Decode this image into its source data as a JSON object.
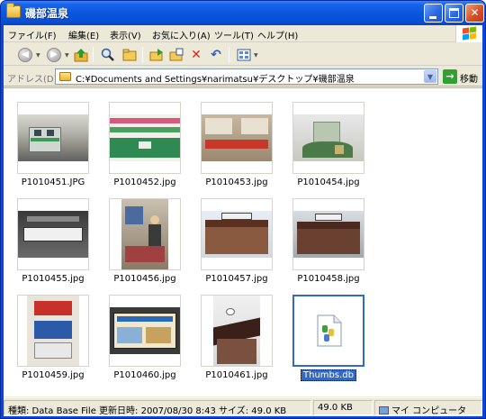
{
  "window": {
    "title": "磯部温泉"
  },
  "menu": {
    "items": [
      "ファイル(F)",
      "編集(E)",
      "表示(V)",
      "お気に入り(A)",
      "ツール(T)",
      "ヘルプ(H)"
    ]
  },
  "toolbar": {
    "icons": [
      "back-icon",
      "forward-icon",
      "up-folder-icon",
      "search-icon",
      "folders-icon",
      "move-to-icon",
      "copy-to-icon",
      "delete-icon",
      "undo-icon",
      "views-icon"
    ]
  },
  "address": {
    "label": "アドレス(D)",
    "path": "C:¥Documents and Settings¥narimatsu¥デスクトップ¥磯部温泉",
    "go_label": "移動"
  },
  "files": [
    {
      "name": "P1010451.JPG"
    },
    {
      "name": "P1010452.jpg"
    },
    {
      "name": "P1010453.jpg"
    },
    {
      "name": "P1010454.jpg"
    },
    {
      "name": "P1010455.jpg"
    },
    {
      "name": "P1010456.jpg"
    },
    {
      "name": "P1010457.jpg"
    },
    {
      "name": "P1010458.jpg"
    },
    {
      "name": "P1010459.jpg"
    },
    {
      "name": "P1010460.jpg"
    },
    {
      "name": "P1010461.jpg"
    },
    {
      "name": "Thumbs.db",
      "selected": true
    }
  ],
  "status": {
    "details": "種類: Data Base File 更新日時: 2007/08/30 8:43 サイズ: 49.0 KB",
    "size": "49.0 KB",
    "location": "マイ コンピュータ"
  },
  "colors": {
    "titlebar": "#0a56de",
    "selection": "#316ac5",
    "chrome": "#ece9d8"
  }
}
